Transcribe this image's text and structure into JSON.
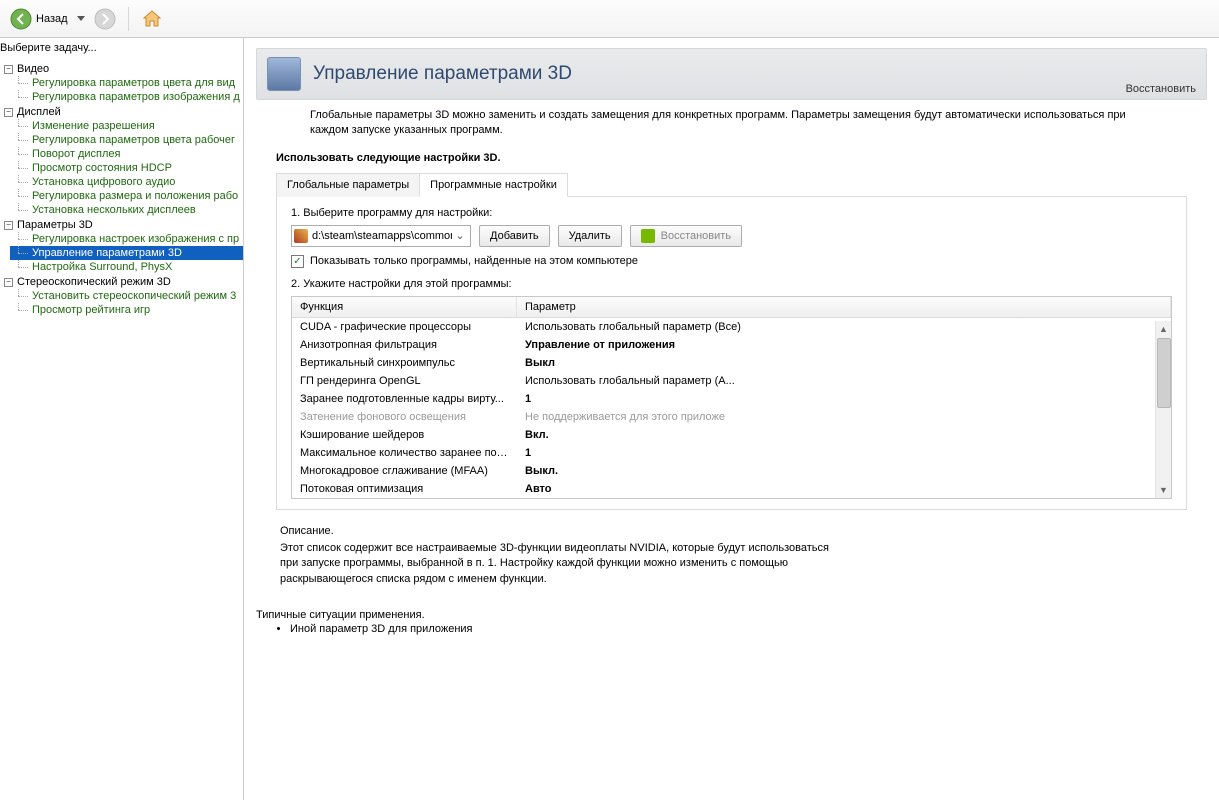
{
  "toolbar": {
    "back": "Назад"
  },
  "sidebar": {
    "task_prompt": "Выберите задачу...",
    "groups": [
      {
        "title": "Видео",
        "items": [
          "Регулировка параметров цвета для вид",
          "Регулировка параметров изображения д"
        ]
      },
      {
        "title": "Дисплей",
        "items": [
          "Изменение разрешения",
          "Регулировка параметров цвета рабочег",
          "Поворот дисплея",
          "Просмотр состояния HDCP",
          "Установка цифрового аудио",
          "Регулировка размера и положения рабо",
          "Установка нескольких дисплеев"
        ]
      },
      {
        "title": "Параметры 3D",
        "items": [
          "Регулировка настроек изображения с пр",
          "Управление параметрами 3D",
          "Настройка Surround, PhysX"
        ],
        "selected": 1
      },
      {
        "title": "Стереоскопический режим 3D",
        "items": [
          "Установить стереоскопический режим 3",
          "Просмотр рейтинга игр"
        ]
      }
    ]
  },
  "page": {
    "title": "Управление параметрами 3D",
    "restore": "Восстановить",
    "intro": "Глобальные параметры 3D можно заменить и создать замещения для конкретных программ. Параметры замещения будут автоматически использоваться при каждом запуске указанных программ.",
    "section": "Использовать следующие настройки 3D.",
    "tabs": [
      "Глобальные параметры",
      "Программные настройки"
    ],
    "active_tab": 1,
    "step1": "1. Выберите программу для настройки:",
    "program_path": "d:\\steam\\steamapps\\common\\r...",
    "btn_add": "Добавить",
    "btn_del": "Удалить",
    "btn_restore": "Восстановить",
    "show_only_label": "Показывать только программы, найденные на этом компьютере",
    "step2": "2. Укажите настройки для этой программы:",
    "columns": [
      "Функция",
      "Параметр"
    ],
    "rows": [
      {
        "f": "CUDA - графические процессоры",
        "p": "Использовать глобальный параметр (Все)"
      },
      {
        "f": "Анизотропная фильтрация",
        "p": "Управление от приложения",
        "bold": true
      },
      {
        "f": "Вертикальный синхроимпульс",
        "p": "Выкл",
        "bold": true
      },
      {
        "f": "ГП рендеринга OpenGL",
        "p": "Использовать глобальный параметр (А..."
      },
      {
        "f": "Заранее подготовленные кадры вирту...",
        "p": "1",
        "bold": true
      },
      {
        "f": "Затенение фонового освещения",
        "p": "Не поддерживается для этого приложе",
        "disabled": true
      },
      {
        "f": "Кэширование шейдеров",
        "p": "Вкл.",
        "bold": true
      },
      {
        "f": "Максимальное количество заранее под...",
        "p": "1",
        "bold": true
      },
      {
        "f": "Многокадровое сглаживание (MFAA)",
        "p": "Выкл.",
        "bold": true
      },
      {
        "f": "Потоковая оптимизация",
        "p": "Авто",
        "bold": true
      }
    ],
    "desc_head": "Описание.",
    "desc_body": "Этот список содержит все настраиваемые 3D-функции видеоплаты NVIDIA, которые будут использоваться при запуске программы, выбранной в п. 1. Настройку каждой функции можно изменить с помощью раскрывающегося списка рядом с именем функции.",
    "typical_head": "Типичные ситуации применения.",
    "typical_item": "Иной параметр 3D для приложения"
  }
}
